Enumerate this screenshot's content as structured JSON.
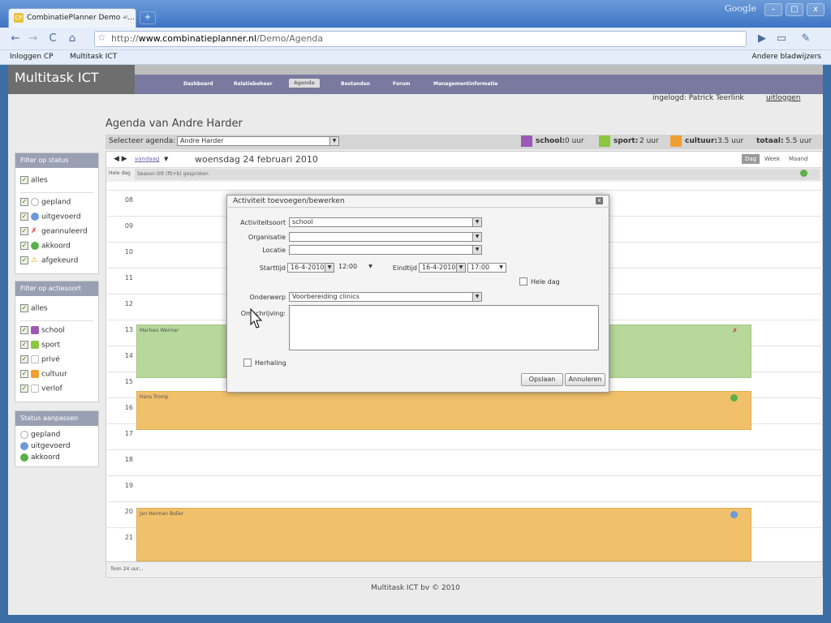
{
  "browser": {
    "tab_title": "CombinatiePlanner Demo - ...",
    "tab_close": "×",
    "newtab": "+",
    "google": "Google",
    "url_domain": "www.combinatieplanner.nl",
    "url_prefix": "http://",
    "url_path": "/Demo/Agenda",
    "bookmarks": [
      "Inloggen CP",
      "Multitask ICT"
    ],
    "other_bookmarks": "Andere bladwijzers"
  },
  "app": {
    "logo": "Multitask ICT",
    "menu": [
      "Dashboard",
      "Relatiebeheer",
      "Agenda",
      "Bestanden",
      "Forum",
      "Managementinformatie"
    ],
    "logged_in": "ingelogd: Patrick Teerlink",
    "logout": "uitloggen",
    "page_title": "Agenda van Andre Harder",
    "select_label": "Selecteer agenda:",
    "select_value": "Andre Harder",
    "totals": [
      {
        "label": "school:",
        "value": "0 uur",
        "color": "#9b59b6"
      },
      {
        "label": "sport:",
        "value": "2 uur",
        "color": "#8cc63f"
      },
      {
        "label": "cultuur:",
        "value": "3.5 uur",
        "color": "#f0a030"
      }
    ],
    "total_label": "totaal:",
    "total_value": "5.5 uur"
  },
  "filter_status": {
    "title": "Filter op status",
    "all": "alles",
    "items": [
      "gepland",
      "uitgevoerd",
      "geannuleerd",
      "akkoord",
      "afgekeurd"
    ]
  },
  "filter_action": {
    "title": "Filter op actiesoort",
    "all": "alles",
    "items": [
      "school",
      "sport",
      "privé",
      "cultuur",
      "verlof"
    ]
  },
  "status_adjust": {
    "title": "Status aanpassen",
    "items": [
      "gepland",
      "uitgevoerd",
      "akkoord"
    ]
  },
  "calendar": {
    "today": "vandaag",
    "date": "woensdag 24 februari 2010",
    "views": [
      "Dag",
      "Week",
      "Maand"
    ],
    "allday_label": "Hele dag",
    "allday_event": "Season Ott (fit+b) gesproken",
    "hours": [
      "08",
      "09",
      "10",
      "11",
      "12",
      "13",
      "14",
      "15",
      "16",
      "17",
      "18",
      "19",
      "20",
      "21"
    ],
    "events": [
      "Marloes Weimar",
      "Hans Tromp",
      "Jan Herman Boller"
    ],
    "show24": "Toon 24 uur..."
  },
  "dialog": {
    "title": "Activiteit toevoegen/bewerken",
    "activiteitsoort_label": "Activiteitsoort",
    "activiteitsoort": "school",
    "organisatie_label": "Organisatie",
    "locatie_label": "Locatie",
    "starttijd_label": "Starttijd",
    "start_date": "16-4-2010",
    "start_time": "12:00",
    "eindtijd_label": "Eindtijd",
    "end_date": "16-4-2010",
    "end_time": "17:00",
    "hele_dag": "Hele dag",
    "onderwerp_label": "Onderwerp",
    "onderwerp": "Voorbereiding clinics",
    "omschrijving_label": "Omschrijving:",
    "herhaling": "Herhaling",
    "save": "Opslaan",
    "cancel": "Annuleren"
  },
  "footer": "Multitask ICT bv © 2010"
}
